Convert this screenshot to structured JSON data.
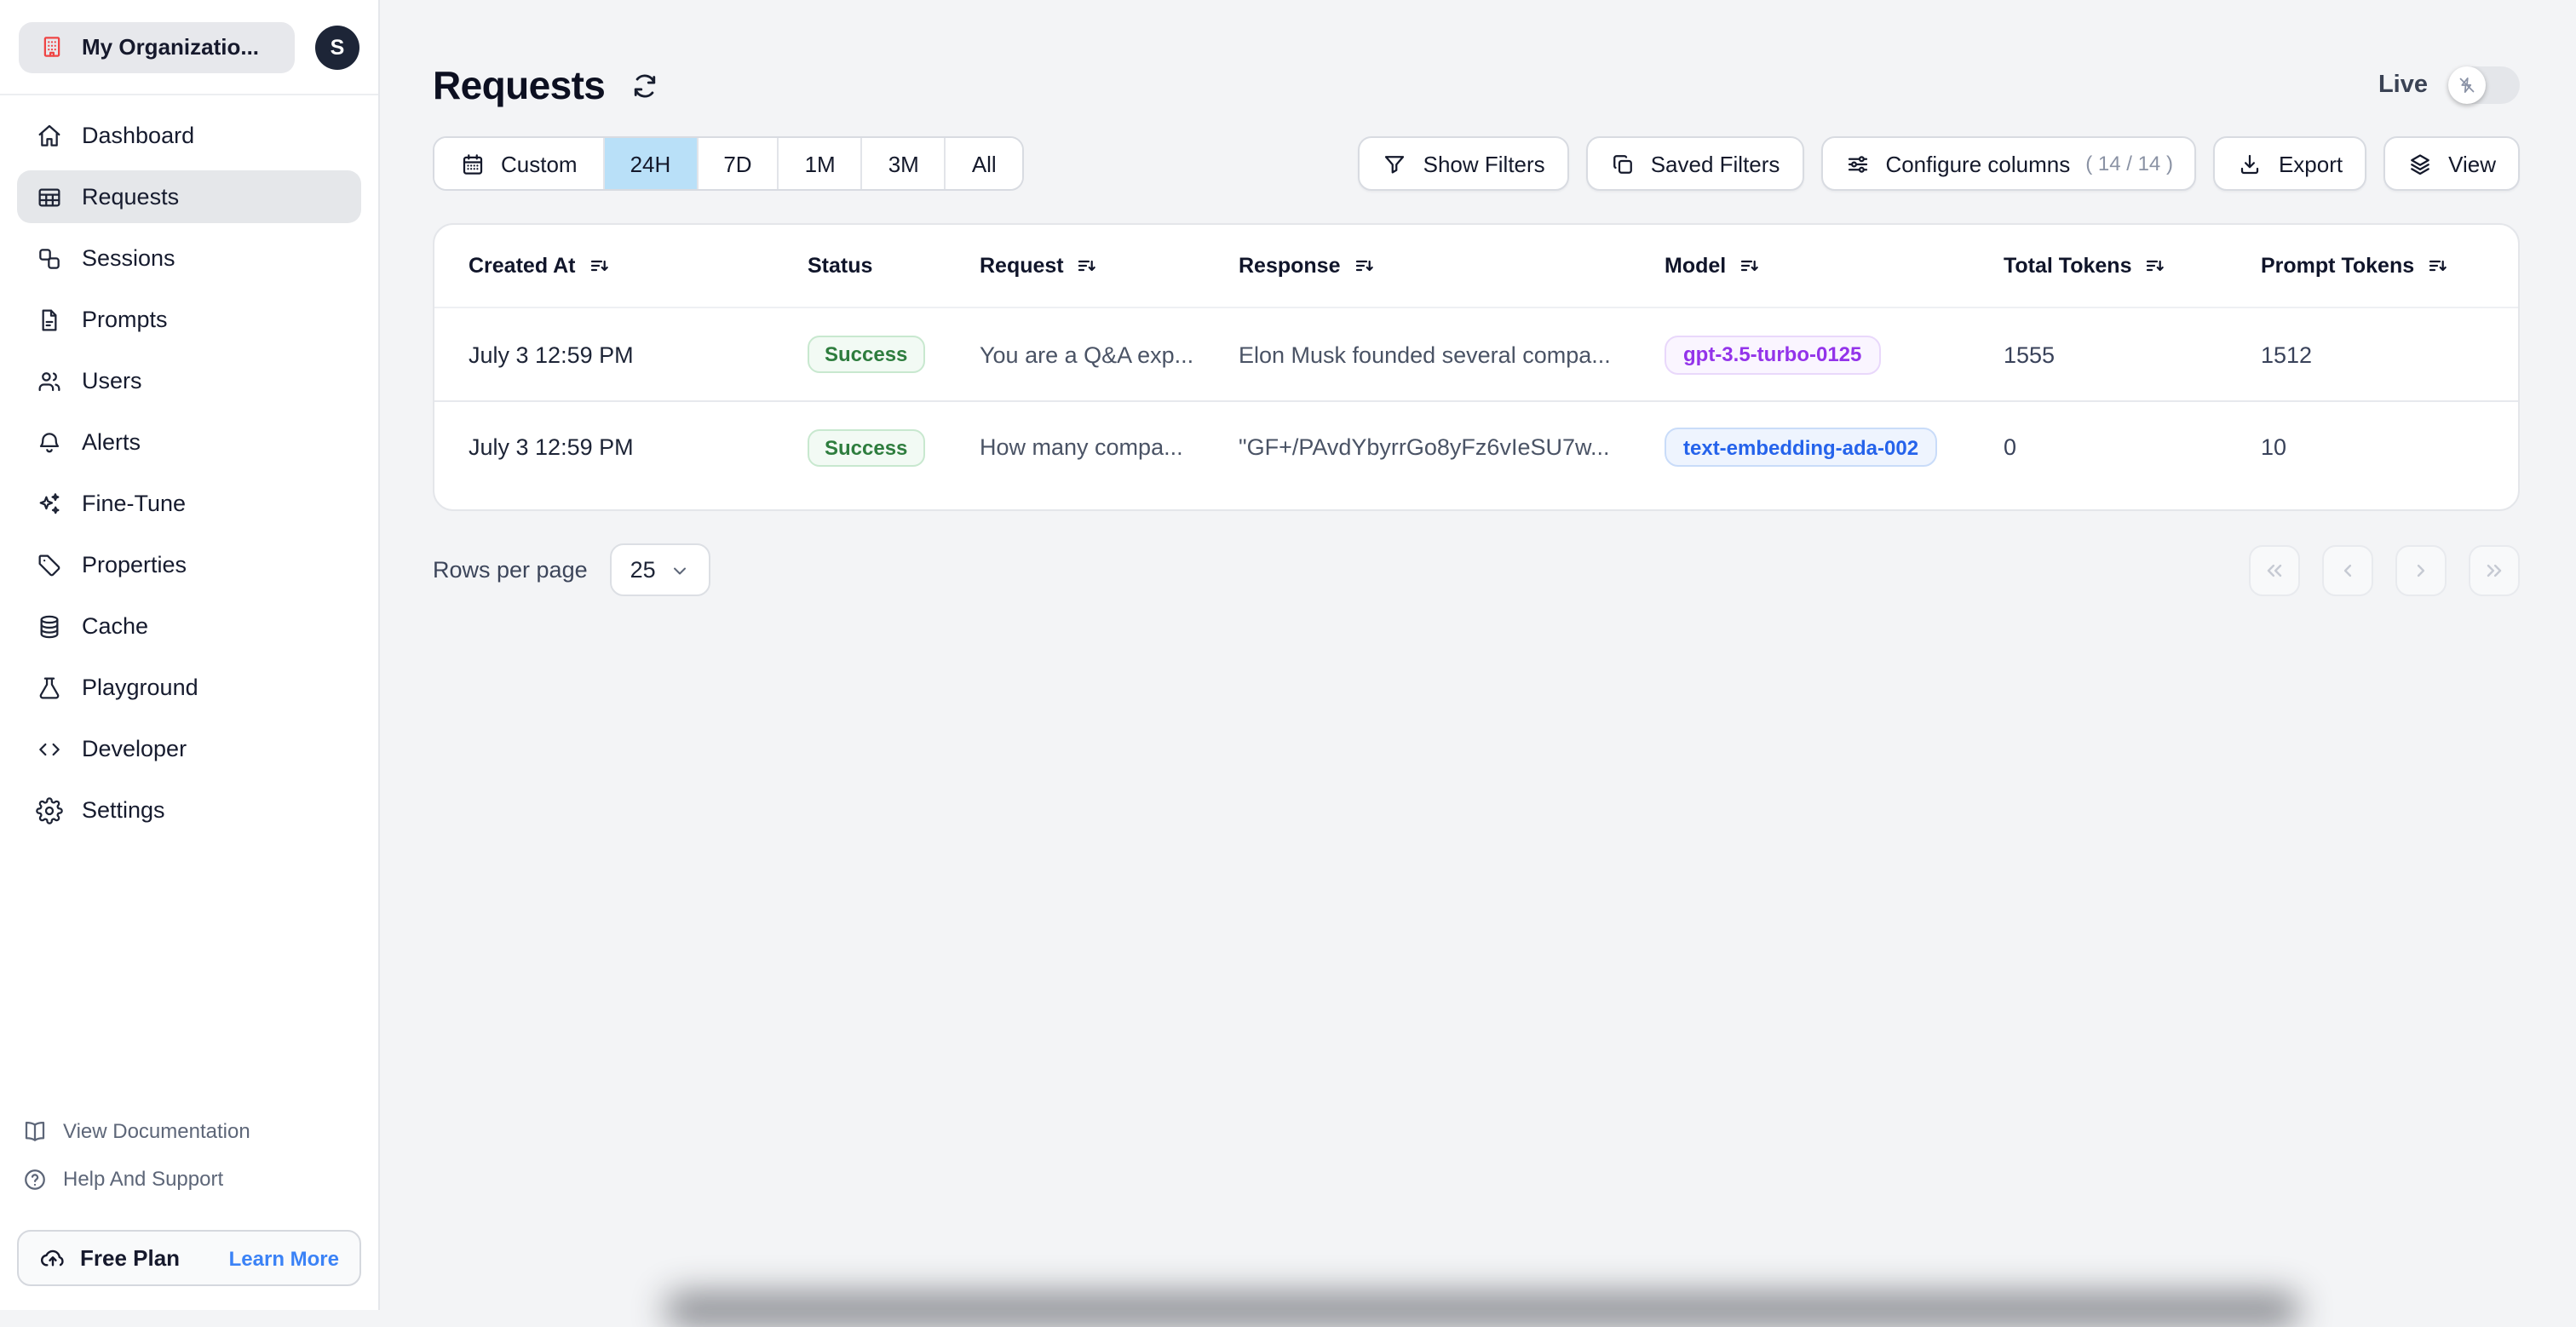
{
  "org": {
    "name": "My Organizatio...",
    "avatar_initial": "S"
  },
  "sidebar": {
    "items": [
      {
        "label": "Dashboard"
      },
      {
        "label": "Requests"
      },
      {
        "label": "Sessions"
      },
      {
        "label": "Prompts"
      },
      {
        "label": "Users"
      },
      {
        "label": "Alerts"
      },
      {
        "label": "Fine-Tune"
      },
      {
        "label": "Properties"
      },
      {
        "label": "Cache"
      },
      {
        "label": "Playground"
      },
      {
        "label": "Developer"
      },
      {
        "label": "Settings"
      }
    ],
    "active_item": "Requests",
    "footer_links": [
      {
        "label": "View Documentation"
      },
      {
        "label": "Help And Support"
      }
    ],
    "plan": {
      "label": "Free Plan",
      "action_label": "Learn More"
    }
  },
  "header": {
    "title": "Requests",
    "live_label": "Live",
    "live_on": false
  },
  "time_range": {
    "custom_label": "Custom",
    "options": [
      "24H",
      "7D",
      "1M",
      "3M",
      "All"
    ],
    "active": "24H"
  },
  "toolbar": {
    "show_filters_label": "Show Filters",
    "saved_filters_label": "Saved Filters",
    "configure_columns_label": "Configure columns",
    "configure_columns_count": "( 14 / 14 )",
    "export_label": "Export",
    "view_label": "View"
  },
  "table": {
    "columns": [
      {
        "label": "Created At",
        "sortable": true
      },
      {
        "label": "Status",
        "sortable": false
      },
      {
        "label": "Request",
        "sortable": true
      },
      {
        "label": "Response",
        "sortable": true
      },
      {
        "label": "Model",
        "sortable": true
      },
      {
        "label": "Total Tokens",
        "sortable": true
      },
      {
        "label": "Prompt Tokens",
        "sortable": true
      }
    ],
    "rows": [
      {
        "created_at": "July 3 12:59 PM",
        "status": "Success",
        "request": "You are a Q&A exp...",
        "response": "Elon Musk founded several compa...",
        "model": "gpt-3.5-turbo-0125",
        "total_tokens": "1555",
        "prompt_tokens": "1512"
      },
      {
        "created_at": "July 3 12:59 PM",
        "status": "Success",
        "request": "How many compa...",
        "response": "\"GF+/PAvdYbyrrGo8yFz6vIeSU7w...",
        "model": "text-embedding-ada-002",
        "total_tokens": "0",
        "prompt_tokens": "10"
      }
    ]
  },
  "pagination": {
    "rows_per_page_label": "Rows per page",
    "rows_per_page_value": "25"
  },
  "colors": {
    "active_range_blue": "#b9e0f8",
    "success_green": "#2e7d3e",
    "model_purple": "#9333ea",
    "model_blue": "#2563eb",
    "link_blue": "#3b82f6",
    "org_icon_red": "#ef4444"
  }
}
